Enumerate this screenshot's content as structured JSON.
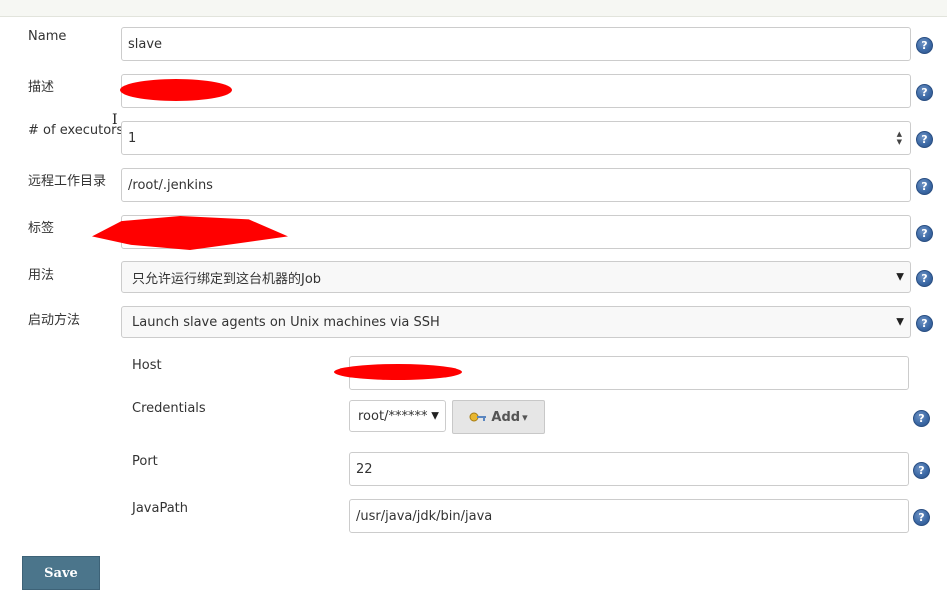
{
  "form": {
    "name": {
      "label": "Name",
      "value": "slave"
    },
    "description": {
      "label": "描述",
      "value": ""
    },
    "executors": {
      "label": "# of executors",
      "value": "1"
    },
    "remote_root": {
      "label": "远程工作目录",
      "value": "/root/.jenkins"
    },
    "labels": {
      "label": "标签",
      "value": ""
    },
    "usage": {
      "label": "用法",
      "value": "只允许运行绑定到这台机器的Job"
    },
    "launch_method": {
      "label": "启动方法",
      "value": "Launch slave agents on Unix machines via SSH"
    }
  },
  "ssh": {
    "host": {
      "label": "Host",
      "value": ""
    },
    "credentials": {
      "label": "Credentials",
      "value": "root/******",
      "add_label": "Add"
    },
    "port": {
      "label": "Port",
      "value": "22"
    },
    "java_path": {
      "label": "JavaPath",
      "value": "/usr/java/jdk/bin/java"
    }
  },
  "actions": {
    "save_label": "Save"
  },
  "help": {
    "glyph": "?"
  },
  "icons": {
    "dropdown": "▼",
    "spin_up": "▲",
    "spin_down": "▼",
    "add_caret": "▾"
  },
  "colors": {
    "save": "#4b758b",
    "help": "#3d6aa6",
    "redaction": "#ff0000"
  }
}
